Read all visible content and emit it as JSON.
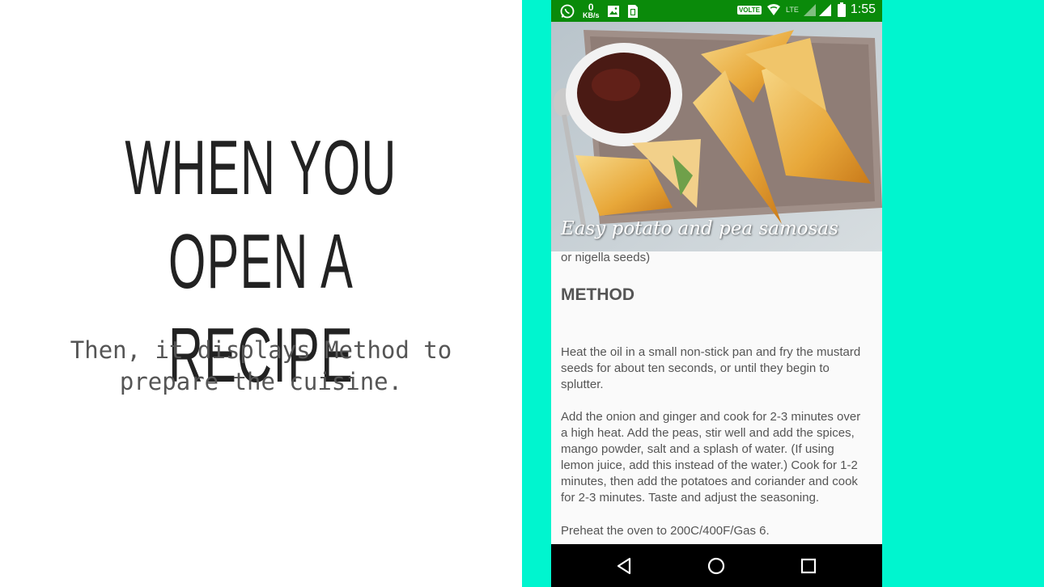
{
  "slide": {
    "title_line1": "WHEN YOU OPEN A",
    "title_line2": "RECIPE",
    "subtitle": "Then, it displays Method to prepare the cuisine.",
    "accent_color": "#00F5CF"
  },
  "status_bar": {
    "data_speed_value": "0",
    "data_speed_unit": "KB/s",
    "volte_label": "VOLTE",
    "lte_label": "LTE",
    "time": "1:55",
    "color": "#0A8A0A",
    "icons": [
      "whatsapp-icon",
      "image-icon",
      "sim-card-icon",
      "wifi-icon",
      "signal-icon",
      "battery-icon"
    ]
  },
  "recipe": {
    "title": "Easy potato and pea samosas",
    "ingredient_fragment": "or nigella seeds)",
    "method_heading": "METHOD",
    "steps": [
      "Heat the oil in a small non-stick pan and fry the mustard seeds for about ten seconds, or until they begin to splutter.",
      "Add the onion and ginger and cook for 2-3 minutes over a high heat. Add the peas, stir well and add the spices, mango powder, salt and a splash of water. (If using lemon juice, add this instead of the water.) Cook for 1-2 minutes, then add the potatoes and coriander and cook for 2-3 minutes. Taste and adjust the seasoning.",
      "Preheat the oven to 200C/400F/Gas 6."
    ]
  },
  "nav_bar": {
    "icons": [
      "back-icon",
      "home-icon",
      "recents-icon"
    ]
  }
}
